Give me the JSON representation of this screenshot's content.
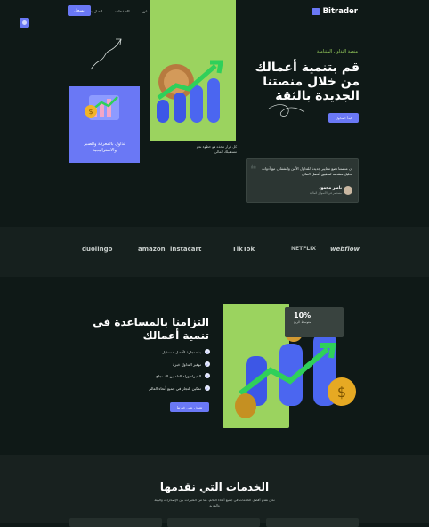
{
  "nav": {
    "logo": "Bitrader",
    "links": [
      "بيت",
      "خدمات",
      "عن",
      "الصفحات",
      "اتصل بنا"
    ],
    "cta": "يسجل"
  },
  "hero": {
    "eyebrow": "منصة التداول المتنامية",
    "title": "قم بتنمية أعمالك من خلال منصتنا الجديدة بالثقة",
    "button": "ابدأ التداول",
    "purple_card_text": "تداول بالمعرفة والصبر والاستراتيجية",
    "note": "كل قرار تتخذه هو خطوة نحو مستقبلك المالي",
    "quote": {
      "text": "إن منصتنا تضع معايير جديدة للتداول الآمن والشفاف مع أدوات تحليل متقدمة لتحقيق أفضل النتائج",
      "name": "ناصر محمود",
      "role": "مستثمر في الأسواق المالية"
    }
  },
  "brands": [
    "duolingo",
    "amazon",
    "instacart",
    "TikTok",
    "NETFLIX",
    "webflow"
  ],
  "section2": {
    "title": "التزامنا بالمساعدة في تنمية أعمالك",
    "features": [
      "بناء تجارة لأفضل مستقبل",
      "توفير التداول خبرة",
      "الخبراء وراء العاملين لك نجاح",
      "تمكين التجار في جميع أنحاء العالم"
    ],
    "button": "تعرف على خبرتنا",
    "stat_value": "10%",
    "stat_label": "متوسط الربح"
  },
  "section3": {
    "title": "الخدمات التي نقدمها",
    "subtitle": "نحن نقدم أفضل الخدمات في جميع أنحاء العالم. هنا من الكثيرات بين الإصدارات والبيئة والمزيد"
  },
  "colors": {
    "accent": "#6a78f5",
    "green": "#9bd35f",
    "bg": "#0f1917"
  }
}
